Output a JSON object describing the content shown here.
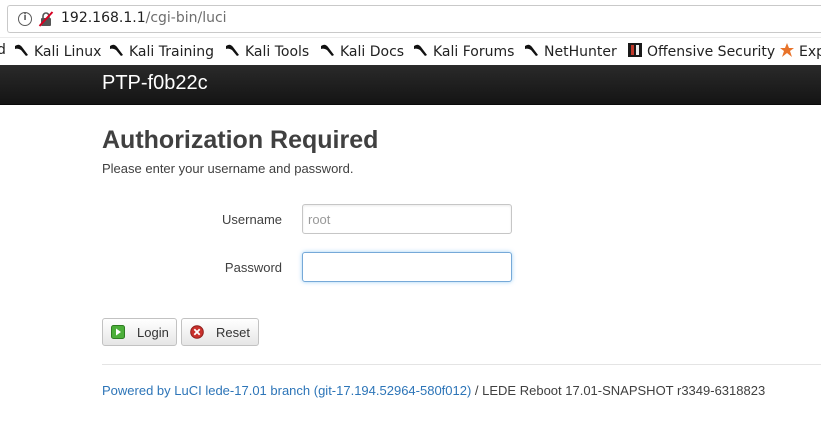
{
  "browser": {
    "url_host": "192.168.1.1",
    "url_path": "/cgi-bin/luci"
  },
  "bookmarks": [
    {
      "label": "d",
      "icon": "kali-dragon-icon"
    },
    {
      "label": "Kali Linux",
      "icon": "kali-dragon-icon"
    },
    {
      "label": "Kali Training",
      "icon": "kali-dragon-icon"
    },
    {
      "label": "Kali Tools",
      "icon": "kali-dragon-icon"
    },
    {
      "label": "Kali Docs",
      "icon": "kali-dragon-icon"
    },
    {
      "label": "Kali Forums",
      "icon": "kali-dragon-icon"
    },
    {
      "label": "NetHunter",
      "icon": "kali-dragon-icon"
    },
    {
      "label": "Offensive Security",
      "icon": "offsec-icon"
    },
    {
      "label": "Exp",
      "icon": "exploit-db-icon"
    }
  ],
  "header": {
    "brand": "PTP-f0b22c"
  },
  "login": {
    "title": "Authorization Required",
    "subtitle": "Please enter your username and password.",
    "username_label": "Username",
    "username_value": "root",
    "password_label": "Password",
    "password_value": "",
    "login_label": "Login",
    "reset_label": "Reset"
  },
  "footer": {
    "link_text": "Powered by LuCI lede-17.01 branch (git-17.194.52964-580f012)",
    "rest_text": " / LEDE Reboot 17.01-SNAPSHOT r3349-6318823"
  },
  "colors": {
    "header_bg": "#1c1c1c",
    "link": "#2d75b8",
    "focus_border": "#76a9d8",
    "login_icon_green": "#4caf3a",
    "reset_icon_red": "#c9302c"
  }
}
